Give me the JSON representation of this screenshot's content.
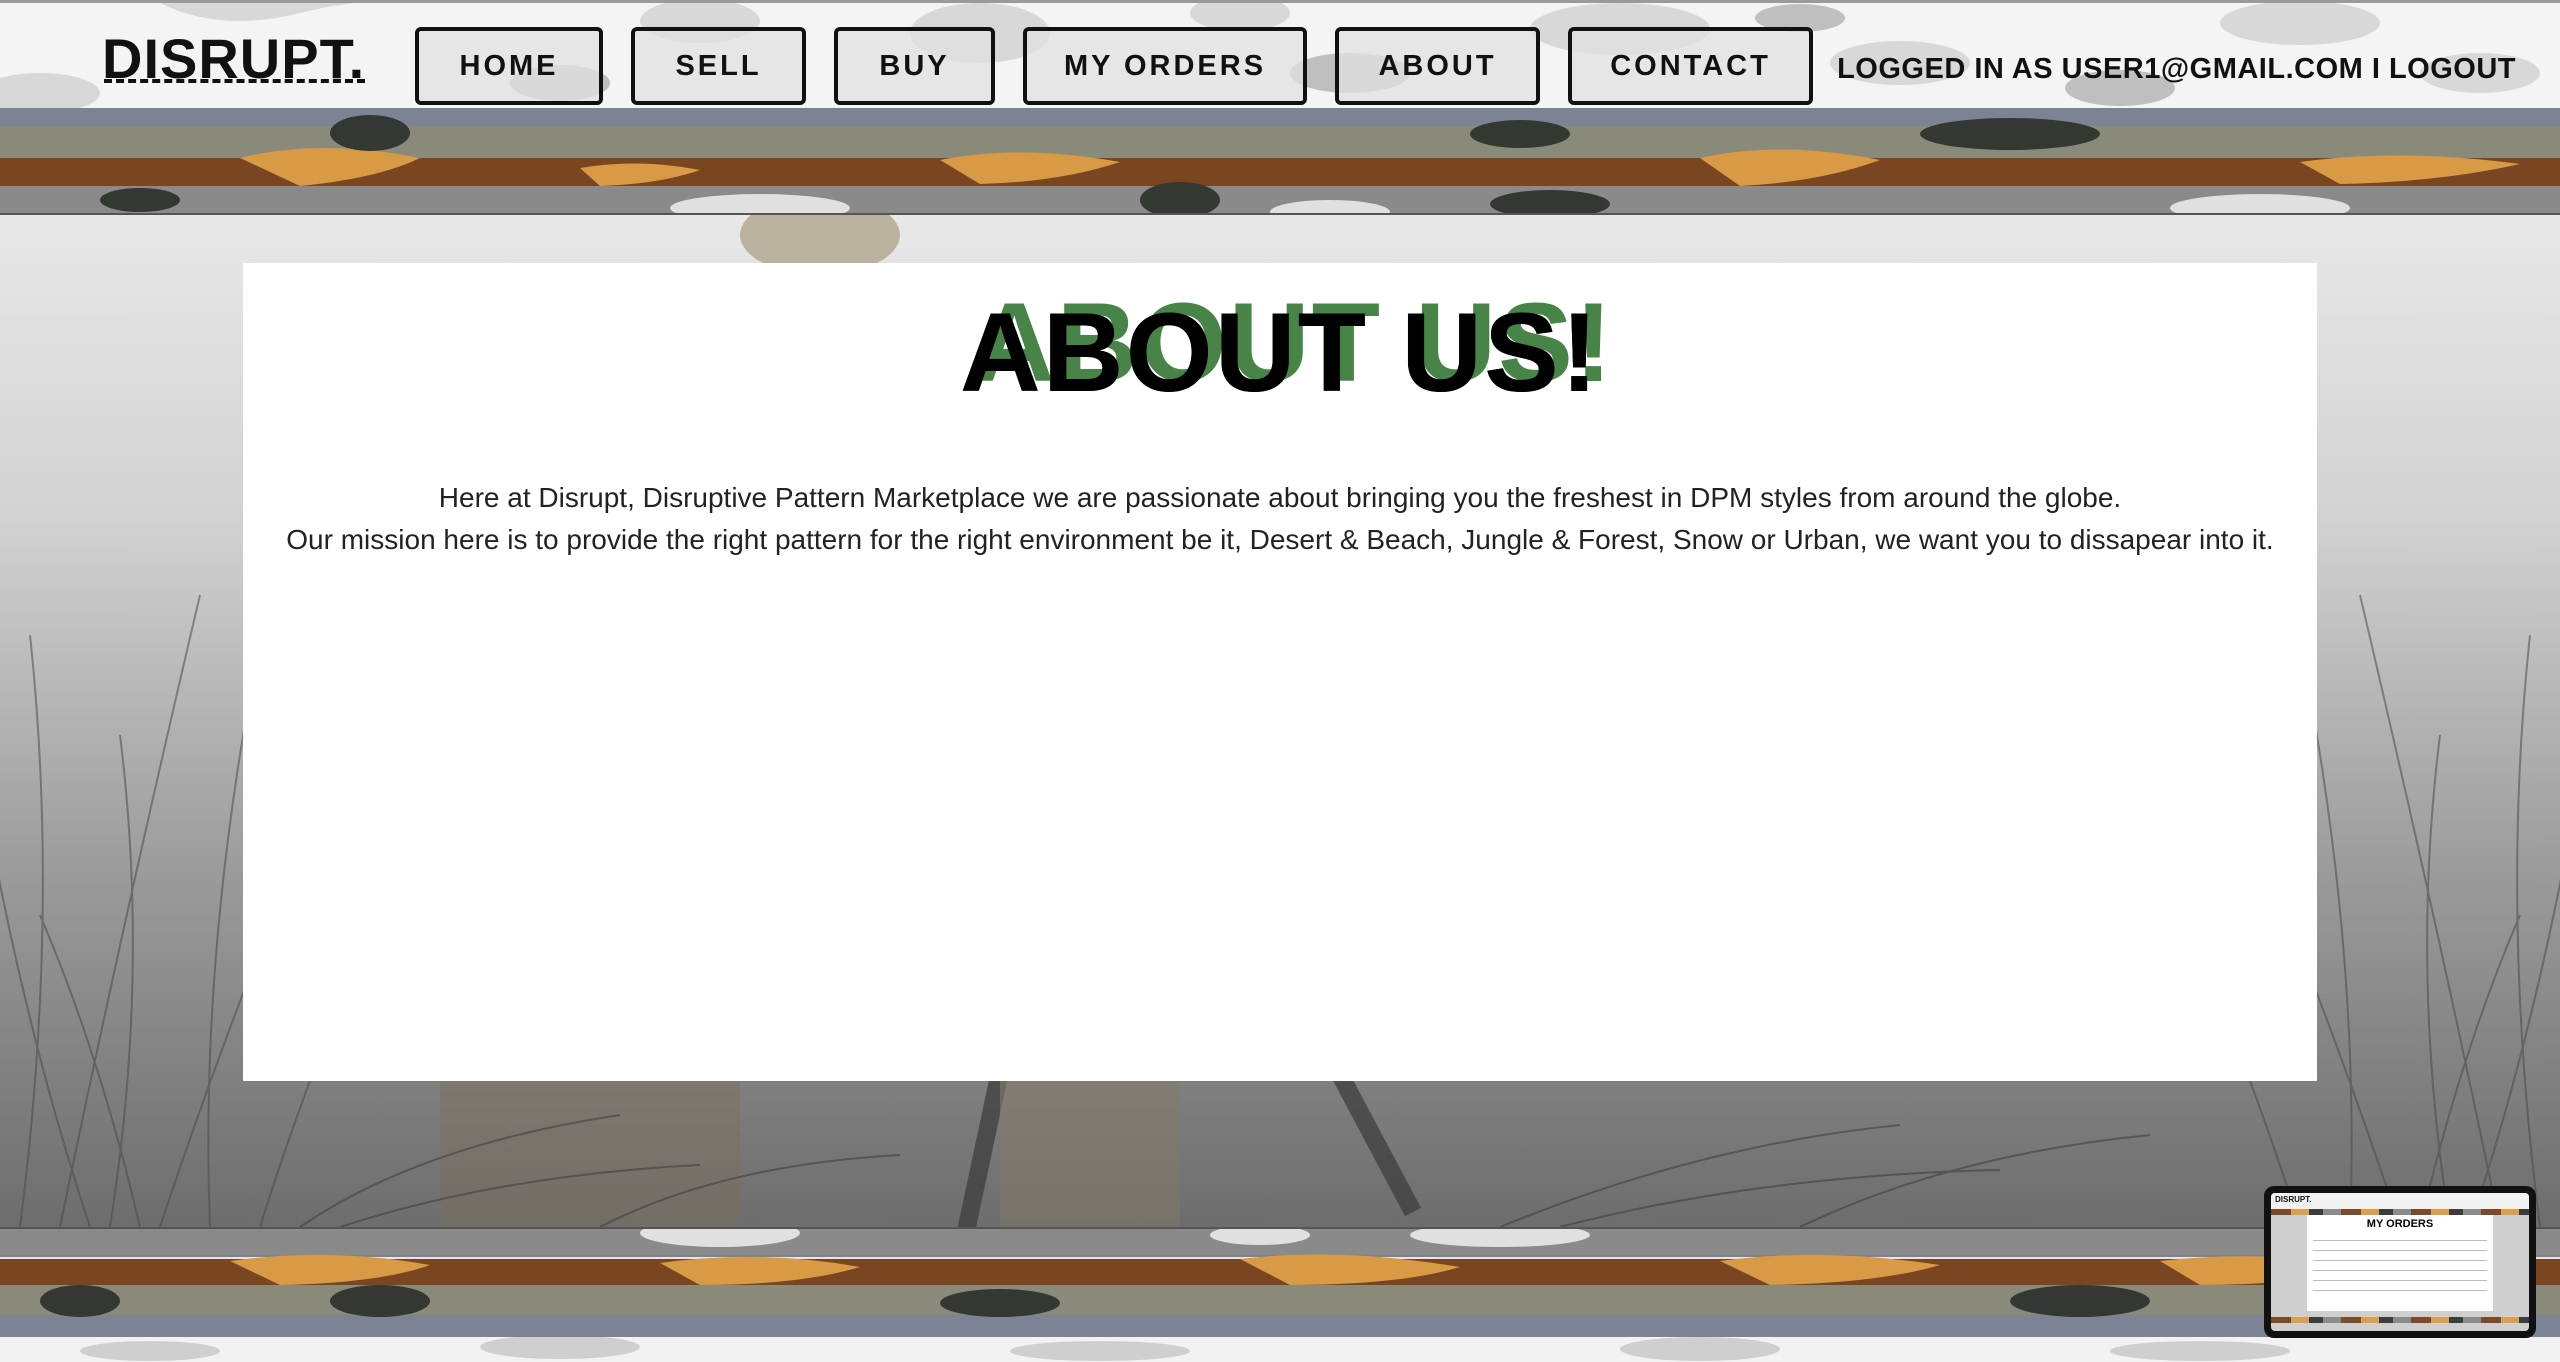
{
  "brand": {
    "logo_text": "DISRUPT."
  },
  "nav": {
    "home": "HOME",
    "sell": "SELL",
    "buy": "BUY",
    "my_orders": "MY ORDERS",
    "about": "ABOUT",
    "contact": "CONTACT"
  },
  "session": {
    "logged_in_prefix": "LOGGED IN AS ",
    "user_email": "USER1@GMAIL.COM",
    "separator": " I ",
    "logout": "LOGOUT"
  },
  "main": {
    "title": "ABOUT US!",
    "paragraph_1": "Here at Disrupt, Disruptive Pattern Marketplace we are passionate about bringing you the freshest in DPM styles from around the globe.",
    "paragraph_2": "Our mission here is to provide the right pattern for the right environment be it, Desert & Beach, Jungle & Forest, Snow or Urban, we want you to dissapear into it."
  },
  "thumbnail": {
    "logo_text": "DISRUPT.",
    "title": "MY ORDERS"
  },
  "colors": {
    "camo_brown": "#7a4622",
    "camo_tan": "#d99a45",
    "camo_dark": "#333833",
    "camo_grey": "#8a8a8a",
    "camo_slate": "#7c8394",
    "panel_bg": "#ffffff",
    "text_dark": "#111111"
  }
}
